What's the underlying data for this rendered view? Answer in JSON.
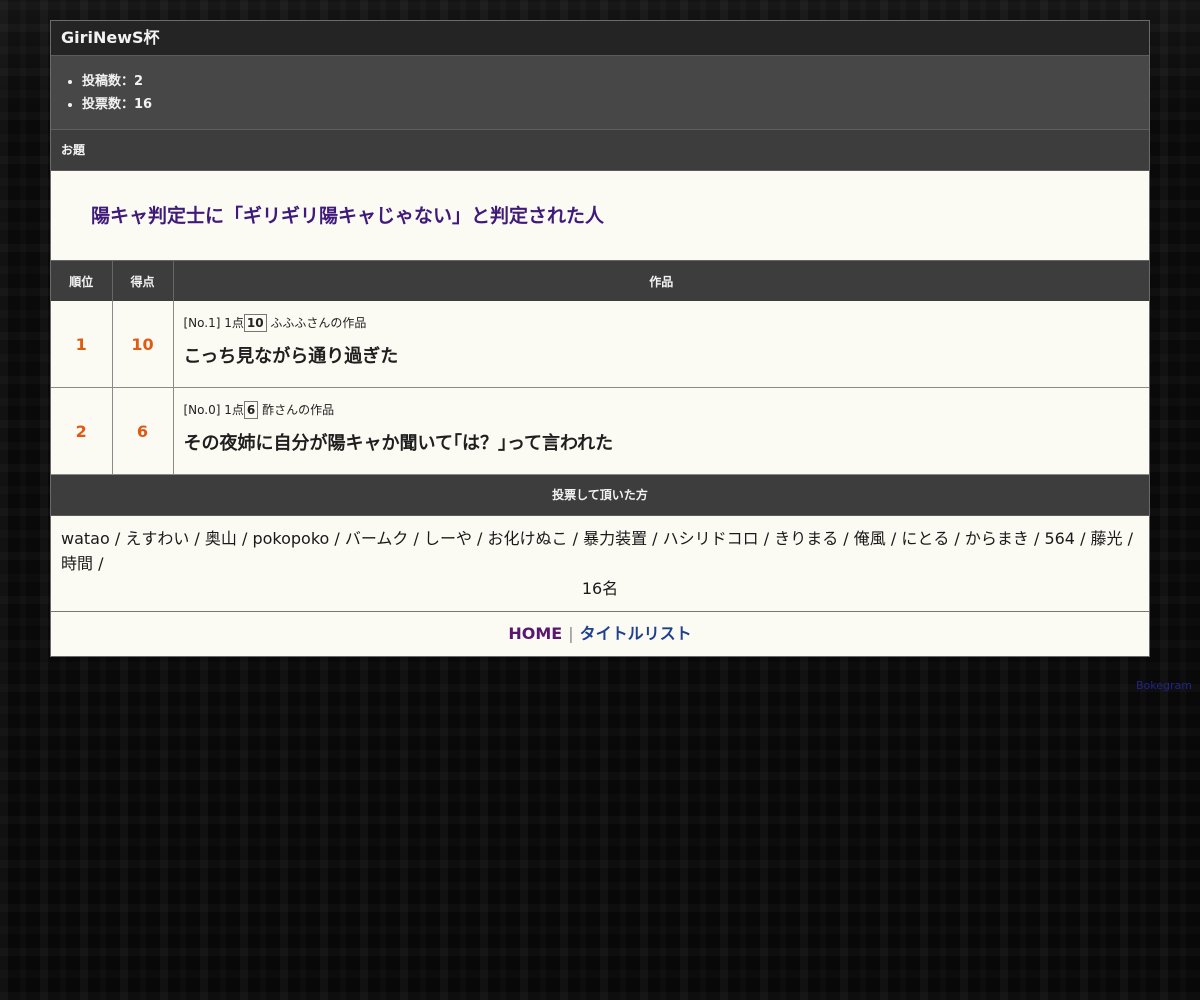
{
  "header": {
    "title": "GiriNewS杯"
  },
  "stats": {
    "posts": "投稿数：2",
    "votes": "投票数：16"
  },
  "odai": {
    "heading": "お題",
    "text": "陽キャ判定士に「ギリギリ陽キャじゃない」と判定された人"
  },
  "table": {
    "headers": {
      "rank": "順位",
      "score": "得点",
      "work": "作品"
    },
    "rows": [
      {
        "rank": "1",
        "score": "10",
        "meta_prefix": "[No.1] 1点",
        "meta_points": "10",
        "meta_author": "ふふふさんの作品",
        "title": "こっち見ながら通り過ぎた"
      },
      {
        "rank": "2",
        "score": "6",
        "meta_prefix": "[No.0] 1点",
        "meta_points": "6",
        "meta_author": "酢さんの作品",
        "title": "その夜姉に自分が陽キャか聞いて｢は？｣って言われた"
      }
    ]
  },
  "voters": {
    "heading": "投票して頂いた方",
    "list": "watao / えすわい / 奥山 / pokopoko / バームク / しーや / お化けぬこ / 暴力装置 / ハシリドコロ / きりまる / 俺風 / にとる / からまき / 564 / 藤光 / 時間 /",
    "count": "16名"
  },
  "footer": {
    "home": "HOME",
    "separator": "|",
    "title_list": "タイトルリスト"
  },
  "credit": "Bokegram",
  "colors": {
    "rank_score": "#e05a14",
    "odai_text": "#3f1a7a",
    "home_link": "#5a1670",
    "list_link": "#1f3f8f"
  }
}
